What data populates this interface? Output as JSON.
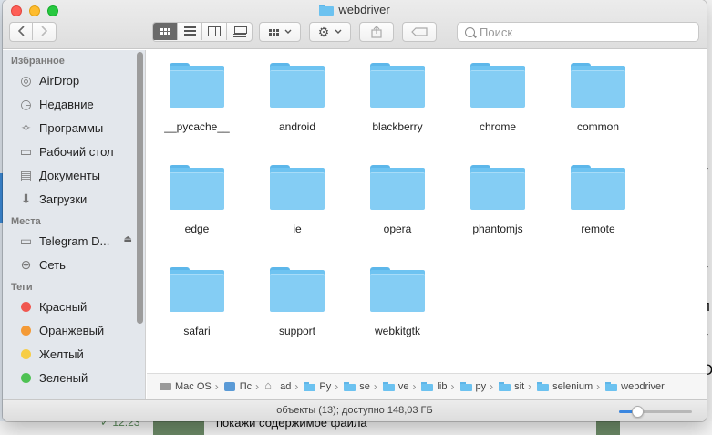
{
  "window": {
    "title": "webdriver"
  },
  "toolbar": {
    "back_icon": "chevron-left-icon",
    "forward_icon": "chevron-right-icon",
    "view_modes": [
      "icon-view",
      "list-view",
      "column-view",
      "gallery-view"
    ],
    "active_view": "icon-view",
    "search_placeholder": "Поиск"
  },
  "sidebar": {
    "sections": [
      {
        "title": "Избранное",
        "items": [
          {
            "label": "AirDrop",
            "icon": "airdrop-icon"
          },
          {
            "label": "Недавние",
            "icon": "clock-icon"
          },
          {
            "label": "Программы",
            "icon": "applications-icon"
          },
          {
            "label": "Рабочий стол",
            "icon": "desktop-icon"
          },
          {
            "label": "Документы",
            "icon": "document-icon"
          },
          {
            "label": "Загрузки",
            "icon": "download-icon"
          }
        ]
      },
      {
        "title": "Места",
        "items": [
          {
            "label": "Telegram D...",
            "icon": "disk-icon",
            "eject": true
          },
          {
            "label": "Сеть",
            "icon": "network-icon"
          }
        ]
      },
      {
        "title": "Теги",
        "items": [
          {
            "label": "Красный",
            "color": "#f0574f"
          },
          {
            "label": "Оранжевый",
            "color": "#f49a36"
          },
          {
            "label": "Желтый",
            "color": "#f7cd45"
          },
          {
            "label": "Зеленый",
            "color": "#4ec253"
          }
        ]
      }
    ]
  },
  "files": [
    "__pycache__",
    "android",
    "blackberry",
    "chrome",
    "common",
    "edge",
    "ie",
    "opera",
    "phantomjs",
    "remote",
    "safari",
    "support",
    "webkitgtk"
  ],
  "pathbar": [
    {
      "label": "Mac OS",
      "icon": "disk"
    },
    {
      "label": "Пс",
      "icon": "user"
    },
    {
      "label": "ad",
      "icon": "home"
    },
    {
      "label": "Py",
      "icon": "folder-s"
    },
    {
      "label": "se",
      "icon": "folder-s"
    },
    {
      "label": "ve",
      "icon": "folder-s"
    },
    {
      "label": "lib",
      "icon": "folder-s"
    },
    {
      "label": "py",
      "icon": "folder-s"
    },
    {
      "label": "sit",
      "icon": "folder-s"
    },
    {
      "label": "selenium",
      "icon": "folder-s"
    },
    {
      "label": "webdriver",
      "icon": "folder-s"
    }
  ],
  "status": {
    "text": "объекты (13); доступно 148,03 ГБ",
    "icon_size_fraction": 0.25
  },
  "background": {
    "time": "✓ 12:23",
    "message": "покажи содержимое файла",
    "right_glyphs": [
      "т",
      "т",
      "л",
      "т",
      "О"
    ]
  }
}
